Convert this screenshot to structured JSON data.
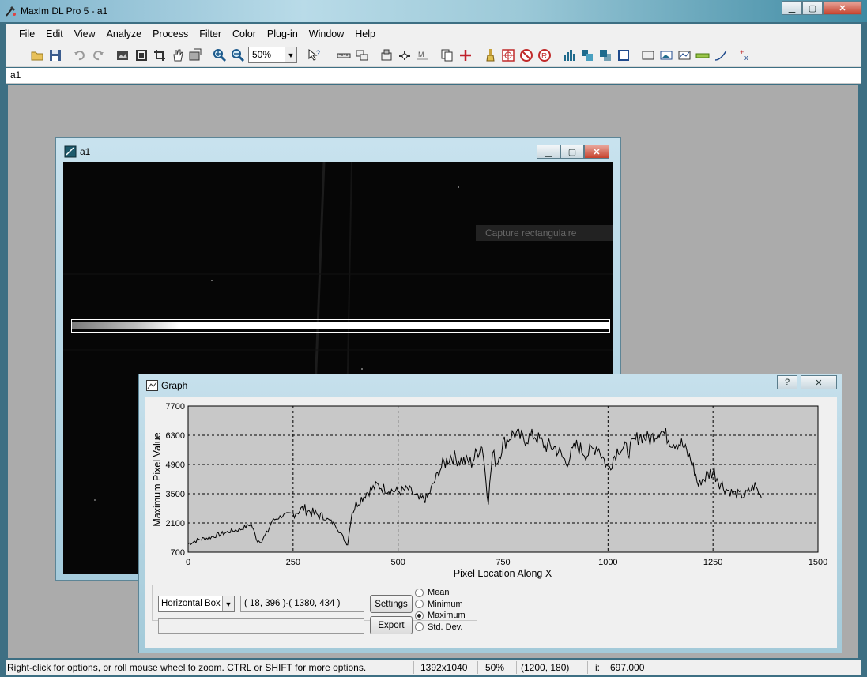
{
  "window": {
    "title": "MaxIm DL Pro 5 - a1",
    "minimize_glyph": "▁",
    "maximize_glyph": "▢",
    "close_glyph": "✕"
  },
  "menu": [
    "File",
    "Edit",
    "View",
    "Analyze",
    "Process",
    "Filter",
    "Color",
    "Plug-in",
    "Window",
    "Help"
  ],
  "toolbar": {
    "zoom_value": "50%",
    "dropdown_glyph": "▼",
    "icons": [
      "open-folder-icon",
      "save-icon",
      "undo-icon",
      "redo-icon",
      "image-icon",
      "fit-icon",
      "crop-icon",
      "hand-icon",
      "screen-stretch-icon",
      "zoom-in-icon",
      "zoom-out-icon",
      "help-pointer-icon",
      "ruler-icon",
      "tool-icon-1",
      "tool-icon-2",
      "tool-icon-3",
      "tool-icon-4",
      "copy-icon",
      "add-icon",
      "brush-icon",
      "target-icon",
      "no-entry-icon",
      "no-entry-icon-2",
      "chart-bars-icon",
      "align-icon",
      "overlap-icon",
      "square-icon",
      "frame-icon",
      "picture-icon",
      "graph-icon",
      "ruler-icon-2",
      "curve-icon",
      "plus-minus-icon"
    ]
  },
  "document_tab": "a1",
  "child_window": {
    "title": "a1",
    "tooltip": "Capture rectangulaire"
  },
  "graph_window": {
    "title": "Graph",
    "help_glyph": "?",
    "close_glyph": "✕",
    "mode": "Horizontal Box",
    "coords": "( 18, 396 )-( 1380, 434 )",
    "status_field": "",
    "settings_label": "Settings",
    "export_label": "Export",
    "options": [
      {
        "label": "Mean",
        "selected": false
      },
      {
        "label": "Minimum",
        "selected": false
      },
      {
        "label": "Maximum",
        "selected": true
      },
      {
        "label": "Std. Dev.",
        "selected": false
      }
    ]
  },
  "chart_data": {
    "type": "line",
    "xlabel": "Pixel Location Along X",
    "ylabel": "Maximum Pixel Value",
    "xlim": [
      0,
      1500
    ],
    "ylim": [
      700,
      7700
    ],
    "xticks": [
      0,
      250,
      500,
      750,
      1000,
      1250,
      1500
    ],
    "yticks": [
      700,
      2100,
      3500,
      4900,
      6300,
      7700
    ],
    "grid": true,
    "series": [
      {
        "x": [
          0,
          25,
          50,
          75,
          100,
          125,
          150,
          165,
          175,
          190,
          200,
          225,
          250,
          275,
          300,
          325,
          350,
          375,
          380,
          390,
          400,
          425,
          450,
          475,
          500,
          525,
          550,
          570,
          600,
          625,
          650,
          675,
          700,
          715,
          725,
          735,
          750,
          775,
          800,
          825,
          850,
          875,
          900,
          925,
          950,
          975,
          1000,
          1025,
          1050,
          1075,
          1100,
          1125,
          1150,
          1175,
          1200,
          1215,
          1225,
          1250,
          1275,
          1300,
          1325,
          1350,
          1365
        ],
        "values": [
          1100,
          1300,
          1400,
          1550,
          1700,
          1800,
          2050,
          1250,
          1250,
          1700,
          2200,
          2450,
          2550,
          2800,
          2550,
          2350,
          2050,
          1200,
          1100,
          2600,
          3000,
          3550,
          3900,
          3700,
          3600,
          3700,
          3200,
          3300,
          4700,
          5300,
          5100,
          5000,
          5900,
          3200,
          5400,
          5000,
          5900,
          6400,
          6100,
          6300,
          5800,
          5700,
          5000,
          5800,
          5400,
          5800,
          4700,
          5700,
          5600,
          6300,
          6100,
          6600,
          6000,
          5900,
          5000,
          3900,
          4200,
          4600,
          3800,
          3500,
          3400,
          3900,
          3300
        ]
      }
    ]
  },
  "status": {
    "hint": "Right-click for options, or roll mouse wheel to zoom. CTRL or SHIFT for more options.",
    "dimensions": "1392x1040",
    "zoom": "50%",
    "cursor": "(1200, 180)",
    "intensity_label": "i:",
    "intensity_value": "697.000"
  }
}
